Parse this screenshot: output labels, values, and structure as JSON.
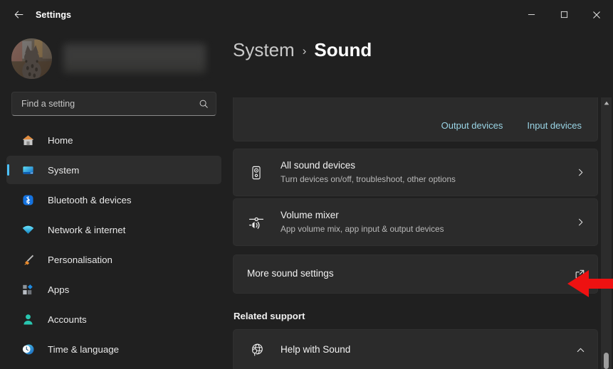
{
  "window": {
    "app_title": "Settings",
    "back_icon": "back-arrow-icon",
    "controls": {
      "minimize": "—",
      "maximize": "□",
      "close": "✕"
    }
  },
  "sidebar": {
    "account": {
      "avatar_icon": "cat-avatar-image",
      "name_redacted": "",
      "email_redacted": ""
    },
    "search": {
      "placeholder": "Find a setting",
      "value": "",
      "icon": "search-icon"
    },
    "items": [
      {
        "label": "Home",
        "icon": "home-icon",
        "selected": false
      },
      {
        "label": "System",
        "icon": "system-display-icon",
        "selected": true
      },
      {
        "label": "Bluetooth & devices",
        "icon": "bluetooth-icon",
        "selected": false
      },
      {
        "label": "Network & internet",
        "icon": "wifi-icon",
        "selected": false
      },
      {
        "label": "Personalisation",
        "icon": "paintbrush-icon",
        "selected": false
      },
      {
        "label": "Apps",
        "icon": "apps-icon",
        "selected": false
      },
      {
        "label": "Accounts",
        "icon": "account-person-icon",
        "selected": false
      },
      {
        "label": "Time & language",
        "icon": "clock-globe-icon",
        "selected": false
      }
    ]
  },
  "content": {
    "breadcrumb": {
      "parent": "System",
      "separator": "›",
      "current": "Sound"
    },
    "device_links": [
      {
        "label": "Output devices"
      },
      {
        "label": "Input devices"
      }
    ],
    "rows": [
      {
        "title": "All sound devices",
        "subtitle": "Turn devices on/off, troubleshoot, other options",
        "icon": "speaker-icon",
        "trailing_icon": "chevron-right-icon"
      },
      {
        "title": "Volume mixer",
        "subtitle": "App volume mix, app input & output devices",
        "icon": "volume-mixer-icon",
        "trailing_icon": "chevron-right-icon"
      },
      {
        "title": "More sound settings",
        "subtitle": "",
        "icon": "",
        "trailing_icon": "external-link-icon"
      }
    ],
    "related_support": {
      "heading": "Related support",
      "items": [
        {
          "title": "Help with Sound",
          "icon": "globe-search-icon",
          "trailing_icon": "chevron-up-icon"
        }
      ]
    }
  },
  "scrollbar": {
    "up_arrow_icon": "scroll-up-arrow-icon",
    "thumb_label": "scrollbar-thumb"
  },
  "annotation": {
    "type": "red-arrow-pointing-left",
    "target": "More sound settings",
    "color": "#ee1111"
  },
  "colors": {
    "accent": "#4cc2ff",
    "link": "#9ad5e6",
    "window_bg": "#202020",
    "card_bg": "#2b2b2b",
    "annotation_red": "#ee1111"
  }
}
